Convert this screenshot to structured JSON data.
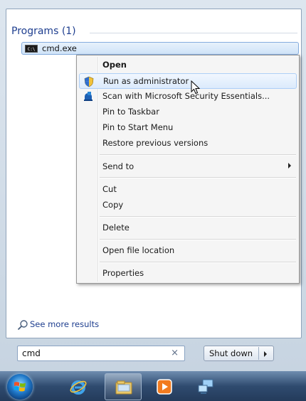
{
  "programs": {
    "header": "Programs (1)",
    "items": [
      {
        "label": "cmd.exe",
        "icon": "command-prompt-icon",
        "icon_text": "C:\\"
      }
    ]
  },
  "context_menu": {
    "groups": [
      [
        {
          "label": "Open",
          "bold": true
        },
        {
          "label": "Run as administrator",
          "icon": "uac-shield-icon",
          "highlighted": true
        },
        {
          "label": "Scan with Microsoft Security Essentials...",
          "icon": "security-essentials-icon"
        },
        {
          "label": "Pin to Taskbar"
        },
        {
          "label": "Pin to Start Menu"
        },
        {
          "label": "Restore previous versions"
        }
      ],
      [
        {
          "label": "Send to",
          "submenu": true
        }
      ],
      [
        {
          "label": "Cut"
        },
        {
          "label": "Copy"
        }
      ],
      [
        {
          "label": "Delete"
        }
      ],
      [
        {
          "label": "Open file location"
        }
      ],
      [
        {
          "label": "Properties"
        }
      ]
    ]
  },
  "see_more": {
    "label": "See more results",
    "icon": "search-icon"
  },
  "search": {
    "value": "cmd",
    "clear_glyph": "×"
  },
  "shutdown": {
    "label": "Shut down",
    "arrow_icon": "chevron-right-icon"
  },
  "taskbar": {
    "items": [
      {
        "name": "start-orb",
        "icon": "windows-logo-icon"
      },
      {
        "name": "internet-explorer",
        "icon": "internet-explorer-icon"
      },
      {
        "name": "windows-explorer",
        "icon": "folder-icon",
        "active": true
      },
      {
        "name": "media-player",
        "icon": "media-player-icon"
      },
      {
        "name": "network",
        "icon": "network-computer-icon"
      }
    ]
  },
  "colors": {
    "link_blue": "#1e3e8f",
    "highlight": "#dbeafc",
    "taskbar": "#2f4b6f"
  }
}
